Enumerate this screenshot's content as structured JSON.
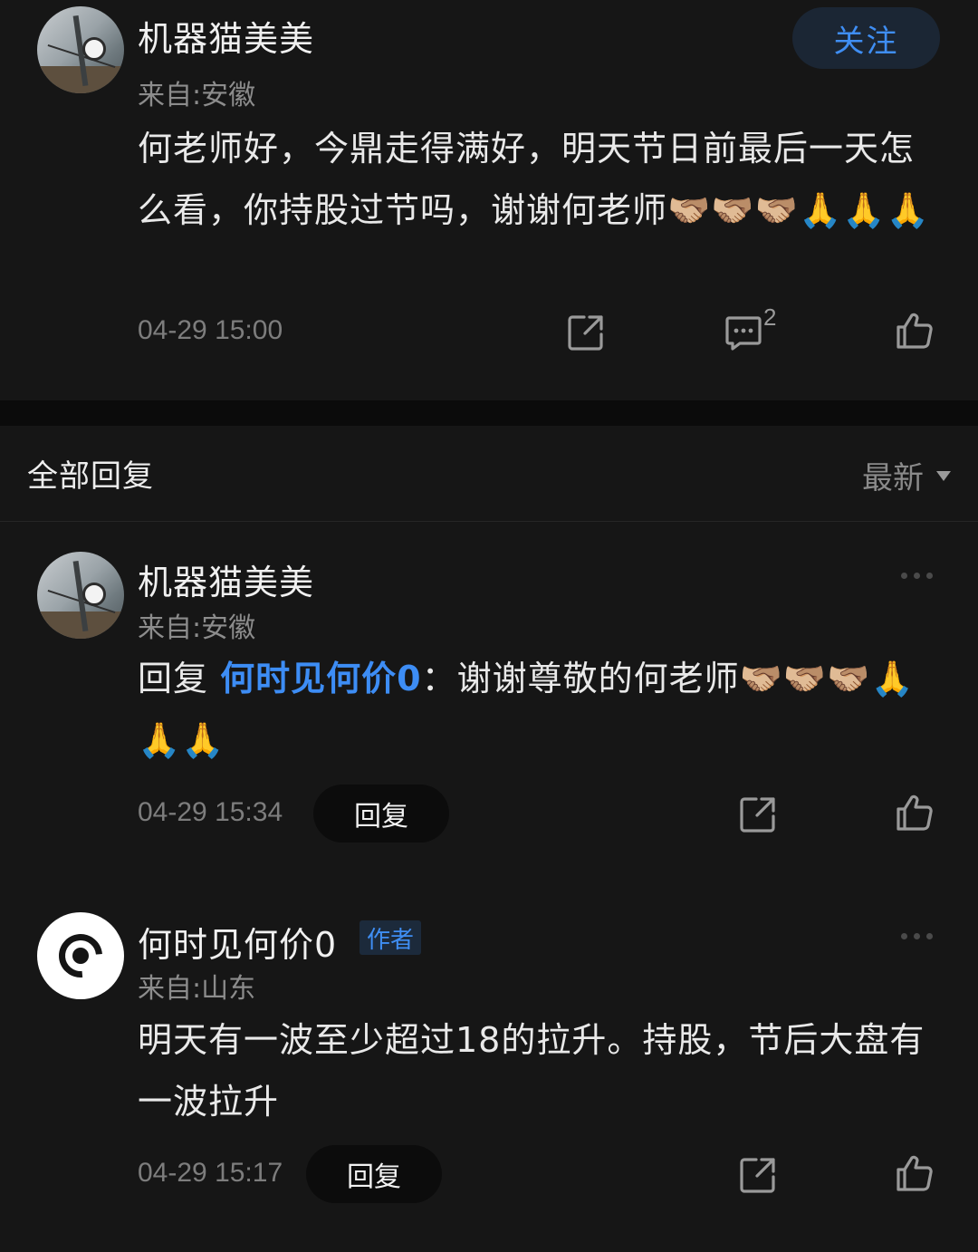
{
  "post": {
    "author": "机器猫美美",
    "location": "来自:安徽",
    "follow_label": "关注",
    "content": "何老师好，今鼎走得满好，明天节日前最后一天怎么看，你持股过节吗，谢谢何老师🫱🏼‍🫲🏽🫱🏼‍🫲🏽🫱🏼‍🫲🏽🙏🙏🙏",
    "timestamp": "04-29 15:00",
    "comment_count": "2",
    "icons": [
      "share-icon",
      "comment-icon",
      "like-icon"
    ]
  },
  "replies_section": {
    "title": "全部回复",
    "sort_label": "最新"
  },
  "replies": [
    {
      "author": "机器猫美美",
      "location": "来自:安徽",
      "reply_prefix": "回复",
      "mention": "何时见何价0",
      "separator": "：",
      "content": "谢谢尊敬的何老师🫱🏼‍🫲🏽🫱🏼‍🫲🏽🫱🏼‍🫲🏽🙏🙏🙏",
      "timestamp": "04-29 15:34",
      "reply_label": "回复"
    },
    {
      "author": "何时见何价0",
      "badge": "作者",
      "location": "来自:山东",
      "content": "明天有一波至少超过18的拉升。持股，节后大盘有一波拉升",
      "timestamp": "04-29 15:17",
      "reply_label": "回复"
    }
  ],
  "colors": {
    "background": "#161616",
    "accent_blue": "#3f8ef3",
    "muted_text": "#8c8c8c"
  }
}
